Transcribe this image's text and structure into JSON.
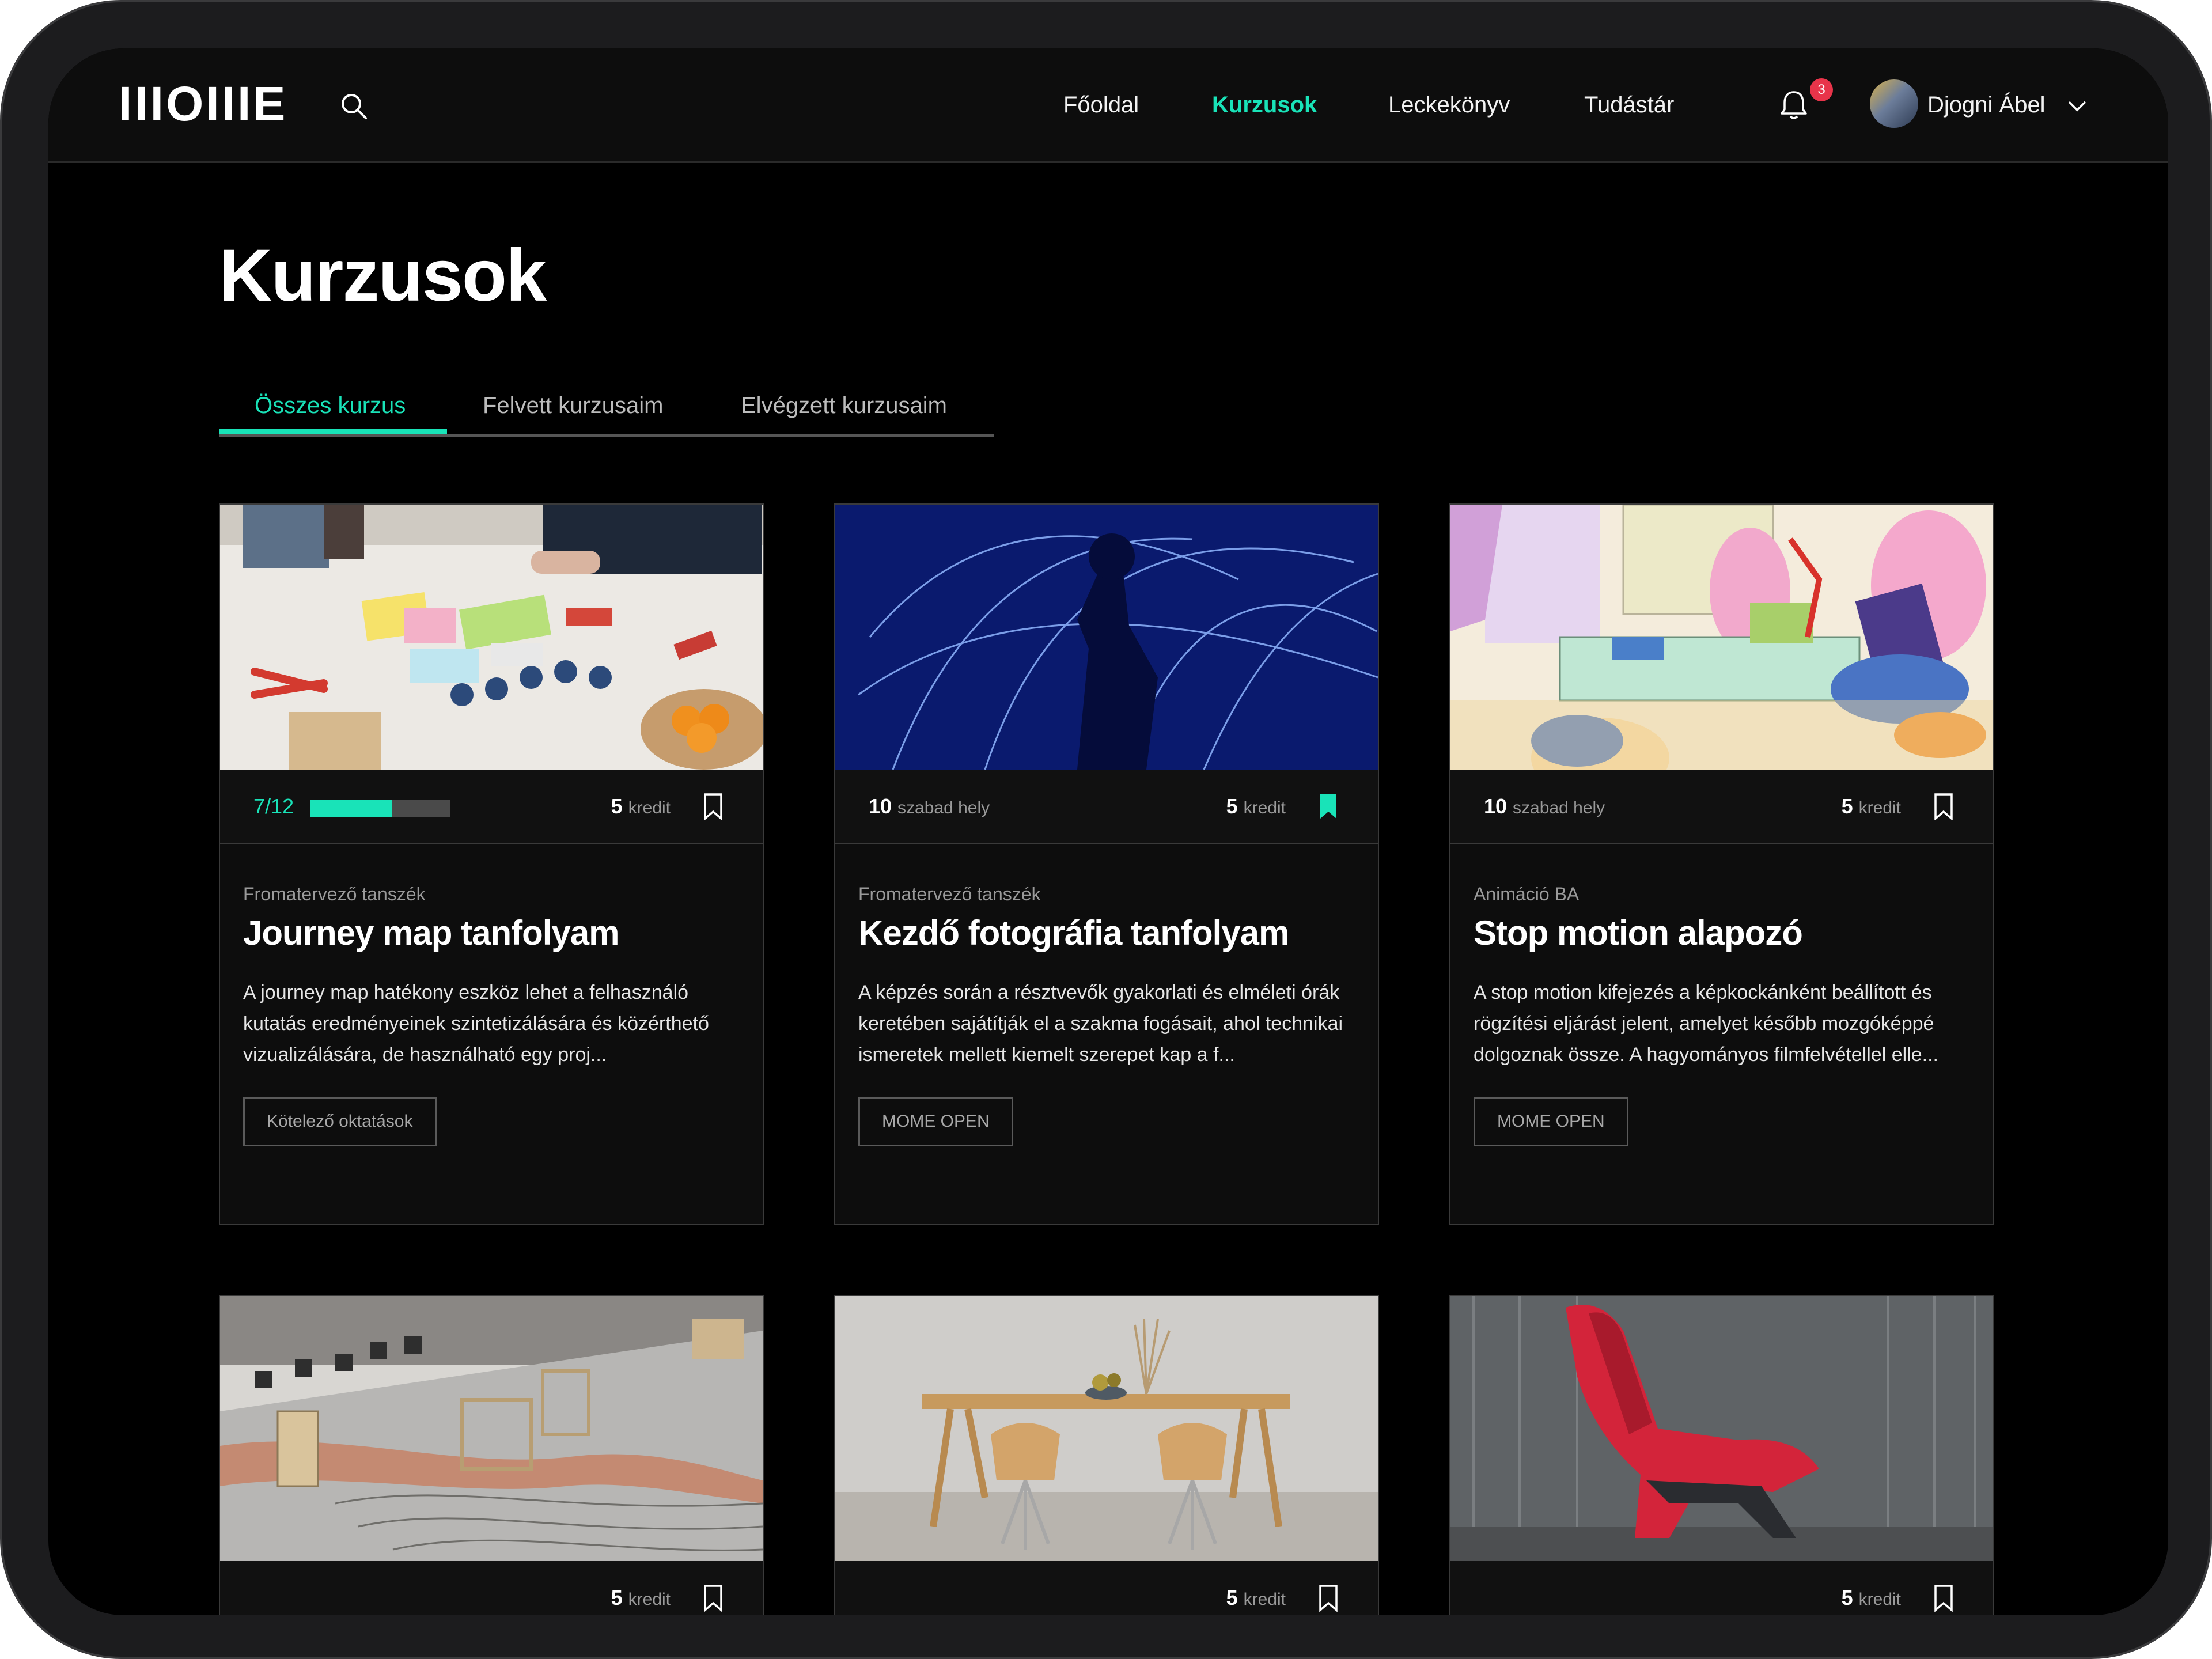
{
  "nav": {
    "logo": "IIIOIIIE",
    "links": [
      "Főoldal",
      "Kurzusok",
      "Leckekönyv",
      "Tudástár"
    ],
    "active_link": "Kurzusok",
    "notifications_count": "3",
    "user_name": "Djogni Ábel"
  },
  "page": {
    "title": "Kurzusok",
    "tabs": [
      "Összes kurzus",
      "Felvett kurzusaim",
      "Elvégzett kurzusaim"
    ],
    "active_tab": "Összes kurzus"
  },
  "colors": {
    "accent": "#19e3b8",
    "background": "#000000",
    "card": "#0d0d0d",
    "badge": "#e8344a"
  },
  "courses": [
    {
      "progress_text": "7/12",
      "progress": 0.58,
      "credits_num": "5",
      "credits_unit": "kredit",
      "bookmarked": false,
      "department": "Fromatervező tanszék",
      "title": "Journey map tanfolyam",
      "description": "A journey map hatékony eszköz lehet a felhasználó kutatás eredményeinek szintetizálására és közérthető vizualizálására, de használható egy proj...",
      "tag": "Kötelező oktatások"
    },
    {
      "seats_num": "10",
      "seats_unit": "szabad hely",
      "credits_num": "5",
      "credits_unit": "kredit",
      "bookmarked": true,
      "department": "Fromatervező tanszék",
      "title": "Kezdő fotográfia tanfolyam",
      "description": "A képzés során a résztvevők gyakorlati és elméleti órák keretében sajátítják el a szakma fogásait, ahol technikai ismeretek mellett kiemelt szerepet kap a f...",
      "tag": "MOME OPEN"
    },
    {
      "seats_num": "10",
      "seats_unit": "szabad hely",
      "credits_num": "5",
      "credits_unit": "kredit",
      "bookmarked": false,
      "department": "Animáció BA",
      "title": "Stop motion alapozó",
      "description": "A stop motion kifejezés a képkockánként beállított és rögzítési eljárást jelent, amelyet később mozgóképpé dolgoznak össze. A hagyományos filmfelvétellel elle...",
      "tag": "MOME OPEN"
    },
    {
      "credits_num": "5",
      "credits_unit": "kredit",
      "bookmarked": false
    },
    {
      "credits_num": "5",
      "credits_unit": "kredit",
      "bookmarked": false
    },
    {
      "credits_num": "5",
      "credits_unit": "kredit",
      "bookmarked": false
    }
  ]
}
